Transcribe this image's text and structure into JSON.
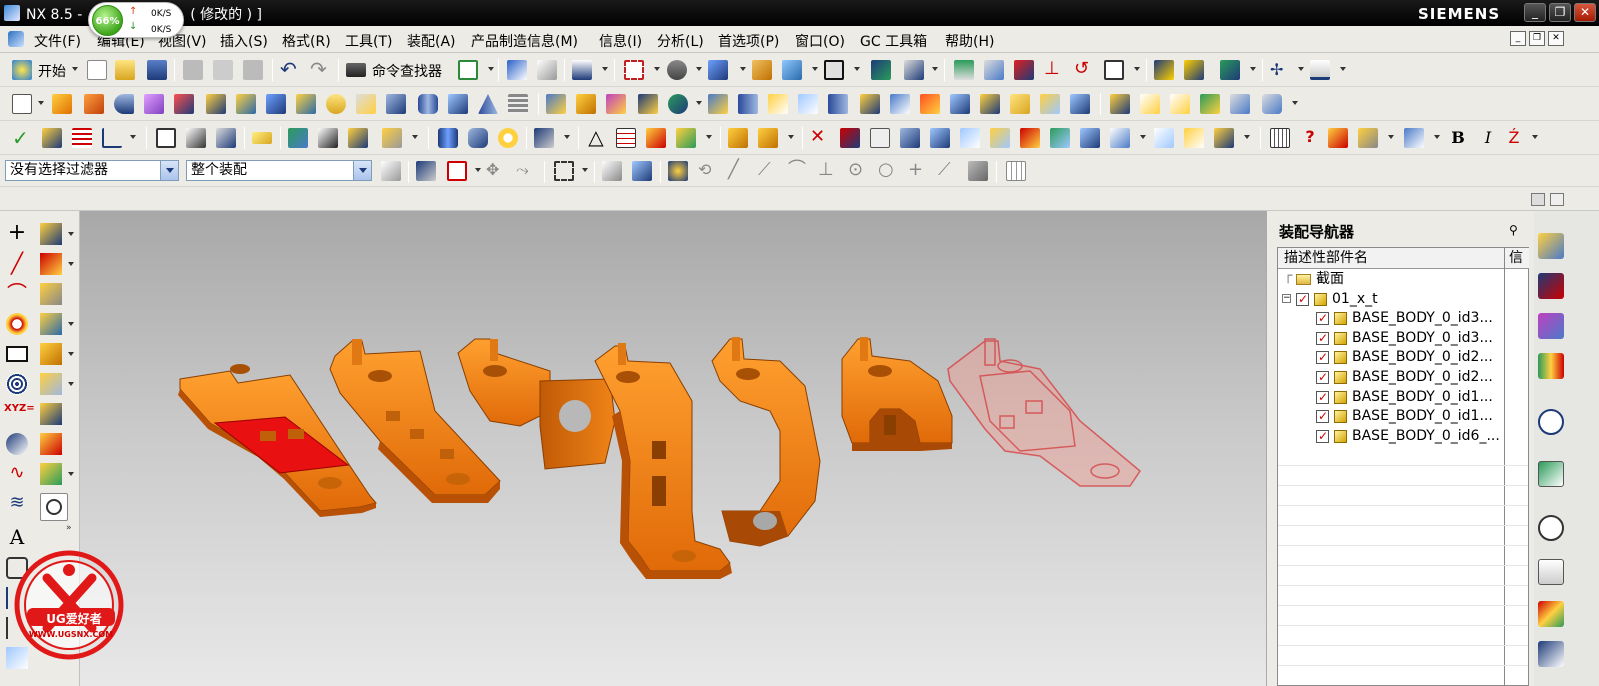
{
  "window": {
    "title": "NX 8.5 - ",
    "title_tail": ".prt  ( 修改的 ) ]",
    "title_hidden_char": "3",
    "brand": "SIEMENS",
    "buttons": [
      "_",
      "❐",
      "✕"
    ]
  },
  "net_meter": {
    "percent": "66%",
    "upload": "0K/S",
    "download": "0K/S"
  },
  "menu": {
    "items": [
      "文件(F)",
      "编辑(E)",
      "视图(V)",
      "插入(S)",
      "格式(R)",
      "工具(T)",
      "装配(A)",
      "产品制造信息(M)",
      "信息(I)",
      "分析(L)",
      "首选项(P)",
      "窗口(O)",
      "GC 工具箱",
      "帮助(H)"
    ],
    "mdi_buttons": [
      "_",
      "❐",
      "✕"
    ]
  },
  "toolbar1": {
    "start_label": "开始",
    "command_finder_label": "命令查找器"
  },
  "filterbar": {
    "selection_filter": "没有选择过滤器",
    "scope": "整个装配"
  },
  "navigator": {
    "title": "装配导航器",
    "column_name": "描述性部件名",
    "column_info": "信",
    "rows": [
      {
        "indent": 0,
        "label": "截面",
        "type": "folder"
      },
      {
        "indent": 0,
        "label": "01_x_t",
        "type": "assembly"
      },
      {
        "indent": 1,
        "label": "BASE_BODY_0_id3...",
        "type": "part"
      },
      {
        "indent": 1,
        "label": "BASE_BODY_0_id3...",
        "type": "part"
      },
      {
        "indent": 1,
        "label": "BASE_BODY_0_id2...",
        "type": "part"
      },
      {
        "indent": 1,
        "label": "BASE_BODY_0_id2...",
        "type": "part"
      },
      {
        "indent": 1,
        "label": "BASE_BODY_0_id1...",
        "type": "part"
      },
      {
        "indent": 1,
        "label": "BASE_BODY_0_id1...",
        "type": "part"
      },
      {
        "indent": 1,
        "label": "BASE_BODY_0_id6_...",
        "type": "part"
      }
    ]
  },
  "lefttoolbar": {
    "text_tool_label": "A",
    "xyz_label": "XYZ="
  },
  "watermark": {
    "brand": "UG爱好者",
    "url": "WWW.UGSNX.COM"
  },
  "colors": {
    "part_orange": "#f07a12",
    "part_dark": "#b24e05",
    "highlight_red": "#e01010",
    "ghost_red": "#e8706a"
  }
}
